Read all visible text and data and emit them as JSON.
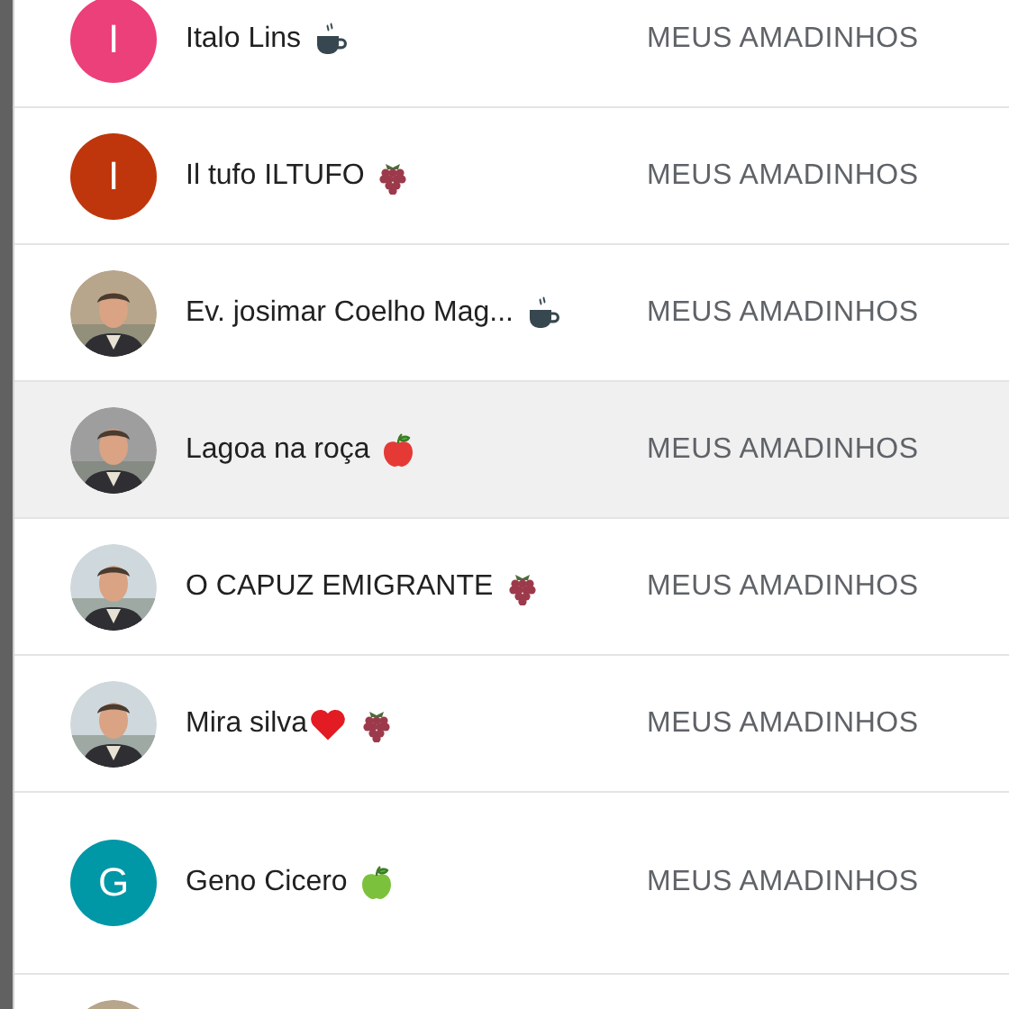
{
  "contacts": [
    {
      "name": "Italo Lins",
      "emoji": [
        {
          "kind": "cup"
        }
      ],
      "avatar": {
        "kind": "letter",
        "letter": "I",
        "color": "#ec407a"
      },
      "action": "MEUS AMADINHOS",
      "selected": false
    },
    {
      "name": "Il tufo ILTUFO",
      "emoji": [
        {
          "kind": "grapes"
        }
      ],
      "avatar": {
        "kind": "letter",
        "letter": "I",
        "color": "#bf360c"
      },
      "action": "MEUS AMADINHOS",
      "selected": false
    },
    {
      "name": "Ev. josimar Coelho Mag...",
      "emoji": [
        {
          "kind": "cup"
        }
      ],
      "avatar": {
        "kind": "picture"
      },
      "action": "MEUS AMADINHOS",
      "selected": false
    },
    {
      "name": "Lagoa na roça",
      "emoji": [
        {
          "kind": "apple",
          "color": "#e53935"
        }
      ],
      "avatar": {
        "kind": "picture"
      },
      "action": "MEUS AMADINHOS",
      "selected": true
    },
    {
      "name": "O CAPUZ EMIGRANTE",
      "emoji": [
        {
          "kind": "grapes"
        }
      ],
      "avatar": {
        "kind": "picture"
      },
      "action": "MEUS AMADINHOS",
      "selected": false
    },
    {
      "name": "Mira silva",
      "emoji": [
        {
          "kind": "heart"
        },
        {
          "kind": "grapes"
        }
      ],
      "avatar": {
        "kind": "picture"
      },
      "action": "MEUS AMADINHOS",
      "selected": false
    },
    {
      "name": "Geno Cicero",
      "emoji": [
        {
          "kind": "apple",
          "color": "#7cc13b"
        }
      ],
      "avatar": {
        "kind": "letter",
        "letter": "G",
        "color": "#0097a7"
      },
      "action": "MEUS AMADINHOS",
      "selected": false
    },
    {
      "avatar": {
        "kind": "picture"
      },
      "selected": false
    }
  ]
}
